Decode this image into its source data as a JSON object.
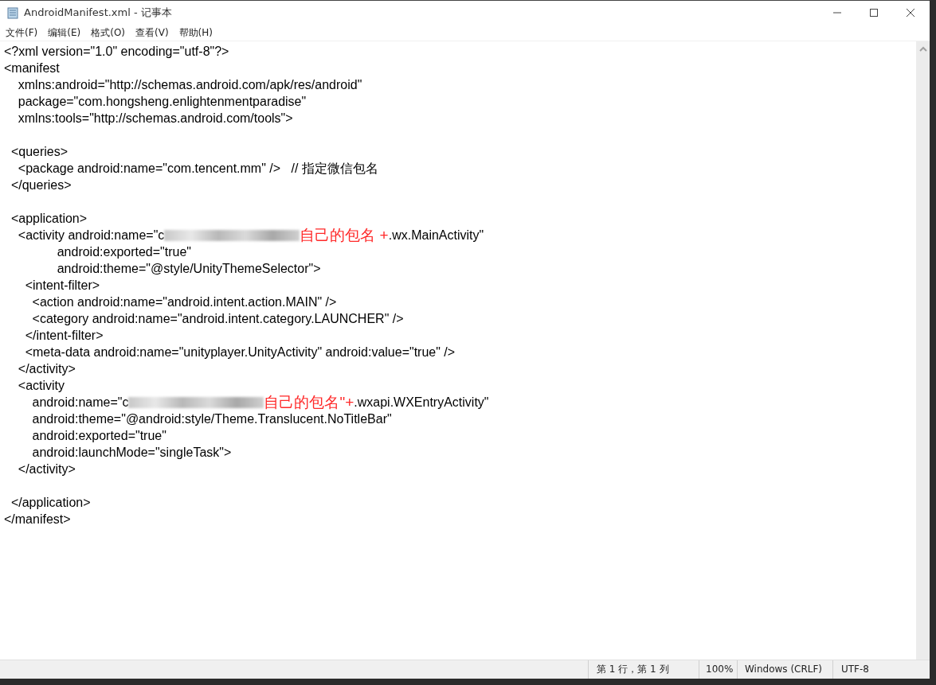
{
  "window": {
    "title": "AndroidManifest.xml - 记事本"
  },
  "menu": [
    {
      "label": "文件(F)"
    },
    {
      "label": "编辑(E)"
    },
    {
      "label": "格式(O)"
    },
    {
      "label": "查看(V)"
    },
    {
      "label": "帮助(H)"
    }
  ],
  "lines": [
    {
      "kind": "code",
      "text": "<?xml version=\"1.0\" encoding=\"utf-8\"?>"
    },
    {
      "kind": "code",
      "text": "<manifest"
    },
    {
      "kind": "code",
      "text": "    xmlns:android=\"http://schemas.android.com/apk/res/android\""
    },
    {
      "kind": "code",
      "text": "    package=\"com.hongsheng.enlightenmentparadise\""
    },
    {
      "kind": "code",
      "text": "    xmlns:tools=\"http://schemas.android.com/tools\">"
    },
    {
      "kind": "blank"
    },
    {
      "kind": "code",
      "text": "  <queries>"
    },
    {
      "kind": "code",
      "text": "    <package android:name=\"com.tencent.mm\" />   // 指定微信包名"
    },
    {
      "kind": "code",
      "text": "  </queries>"
    },
    {
      "kind": "blank"
    },
    {
      "kind": "code",
      "text": "  <application>"
    },
    {
      "kind": "redacted",
      "before": "    <activity android:name=\"c",
      "note": "自己的包名 +",
      "after": ".wx.MainActivity\""
    },
    {
      "kind": "code",
      "text": "               android:exported=\"true\""
    },
    {
      "kind": "code",
      "text": "               android:theme=\"@style/UnityThemeSelector\">"
    },
    {
      "kind": "code",
      "text": "      <intent-filter>"
    },
    {
      "kind": "code",
      "text": "        <action android:name=\"android.intent.action.MAIN\" />"
    },
    {
      "kind": "code",
      "text": "        <category android:name=\"android.intent.category.LAUNCHER\" />"
    },
    {
      "kind": "code",
      "text": "      </intent-filter>"
    },
    {
      "kind": "code",
      "text": "      <meta-data android:name=\"unityplayer.UnityActivity\" android:value=\"true\" />"
    },
    {
      "kind": "code",
      "text": "    </activity>"
    },
    {
      "kind": "code",
      "text": "    <activity"
    },
    {
      "kind": "redacted",
      "before": "        android:name=\"c",
      "note": "自己的包名\"+",
      "after": ".wxapi.WXEntryActivity\""
    },
    {
      "kind": "code",
      "text": "        android:theme=\"@android:style/Theme.Translucent.NoTitleBar\""
    },
    {
      "kind": "code",
      "text": "        android:exported=\"true\""
    },
    {
      "kind": "code",
      "text": "        android:launchMode=\"singleTask\">"
    },
    {
      "kind": "code",
      "text": "    </activity>"
    },
    {
      "kind": "blank"
    },
    {
      "kind": "code",
      "text": "  </application>"
    },
    {
      "kind": "code",
      "text": "</manifest>"
    }
  ],
  "status_bar": {
    "position": "第 1 行，第 1 列",
    "zoom": "100%",
    "line_ending": "Windows (CRLF)",
    "encoding": "UTF-8"
  }
}
